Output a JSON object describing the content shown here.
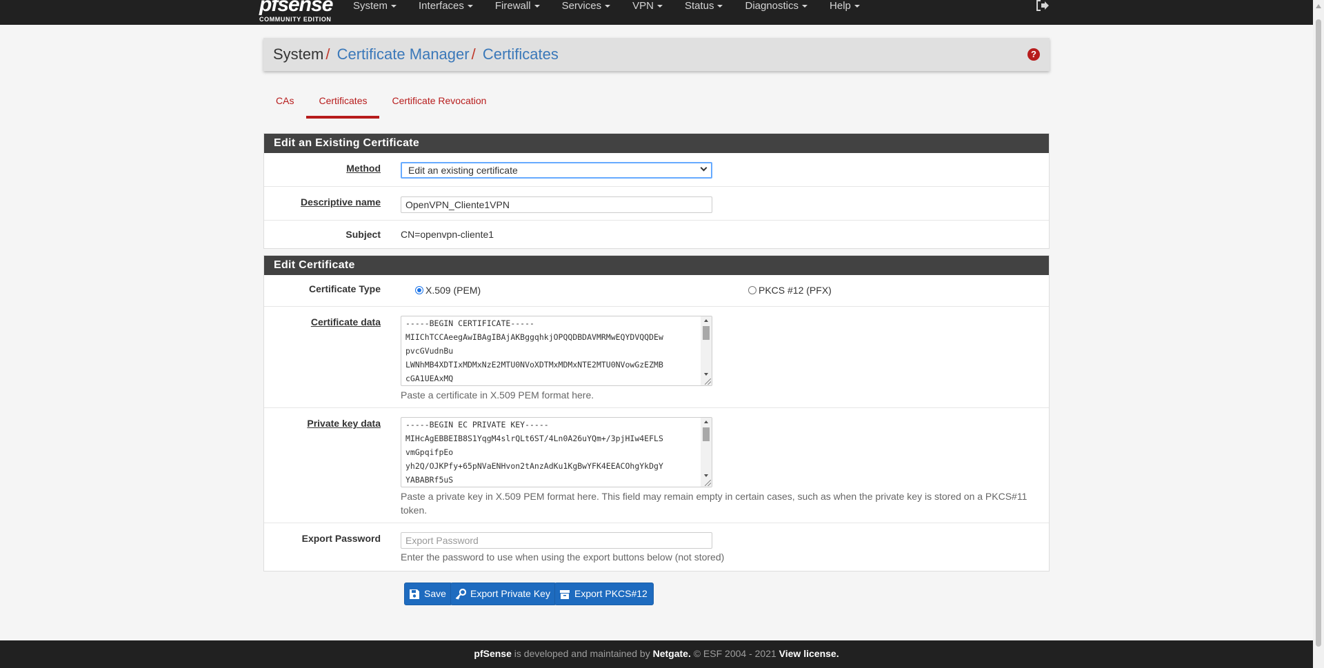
{
  "nav": {
    "logo_text": "pfsense",
    "logo_sub": "COMMUNITY EDITION",
    "items": [
      {
        "label": "System"
      },
      {
        "label": "Interfaces"
      },
      {
        "label": "Firewall"
      },
      {
        "label": "Services"
      },
      {
        "label": "VPN"
      },
      {
        "label": "Status"
      },
      {
        "label": "Diagnostics"
      },
      {
        "label": "Help"
      }
    ]
  },
  "breadcrumb": {
    "root": "System",
    "sep": "/",
    "level2": "Certificate Manager",
    "level3": "Certificates"
  },
  "tabs": [
    {
      "label": "CAs",
      "active": false
    },
    {
      "label": "Certificates",
      "active": true
    },
    {
      "label": "Certificate Revocation",
      "active": false
    }
  ],
  "edit_existing": {
    "heading": "Edit an Existing Certificate",
    "method_label": "Method",
    "method_value": "Edit an existing certificate",
    "descr_label": "Descriptive name",
    "descr_value": "OpenVPN_Cliente1VPN",
    "subject_label": "Subject",
    "subject_value": "CN=openvpn-cliente1"
  },
  "edit_cert": {
    "heading": "Edit Certificate",
    "type_label": "Certificate Type",
    "type_options": [
      "X.509 (PEM)",
      "PKCS #12 (PFX)"
    ],
    "type_selected": "X.509 (PEM)",
    "cert_label": "Certificate data",
    "cert_lines": [
      "-----BEGIN CERTIFICATE-----",
      "MIIChTCCAeegAwIBAgIBAjAKBggqhkjOPQQDBDAVMRMwEQYDVQQDEw",
      "pvcGVudnBu",
      "LWNhMB4XDTIxMDMxNzE2MTU0NVoXDTMxMDMxNTE2MTU0NVowGzEZMB",
      "cGA1UEAxMQ"
    ],
    "cert_help": "Paste a certificate in X.509 PEM format here.",
    "key_label": "Private key data",
    "key_lines": [
      "-----BEGIN EC PRIVATE KEY-----",
      "MIHcAgEBBEIB8S1YqgM4slrQLt6ST/4Ln0A26uYQm+/3pjHIw4EFLS",
      "vmGpqifpEo",
      "yh2Q/OJKPfy+65pNVaENHvon2tAnzAdKu1KgBwYFK4EEACOhgYkDgY",
      "YABABRf5uS"
    ],
    "key_help": "Paste a private key in X.509 PEM format here. This field may remain empty in certain cases, such as when the private key is stored on a PKCS#11 token.",
    "export_label": "Export Password",
    "export_placeholder": "Export Password",
    "export_help": "Enter the password to use when using the export buttons below (not stored)"
  },
  "buttons": {
    "save": "Save",
    "export_key": "Export Private Key",
    "export_pkcs": "Export PKCS#12"
  },
  "footer": {
    "brand": "pfSense",
    "text1": " is developed and maintained by ",
    "company": "Netgate.",
    "text2": " © ESF 2004 - 2021 ",
    "license": "View license."
  },
  "colors": {
    "nav_bg": "#212121",
    "accent_red": "#b71c1c",
    "link_blue": "#3a78b9",
    "button_blue": "#1e6bbf",
    "panel_heading": "#424242"
  }
}
